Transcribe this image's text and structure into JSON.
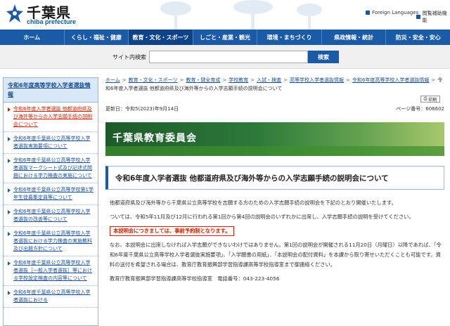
{
  "header": {
    "title": "千葉県",
    "subtitle": "chiba prefecture",
    "foreign_languages": "Foreign Languages",
    "reading_assist": "閲覧補助機能"
  },
  "nav": {
    "items": [
      {
        "label": "ホーム"
      },
      {
        "label": "くらし・福祉・健康"
      },
      {
        "label": "教育・文化・スポーツ"
      },
      {
        "label": "しごと・産業・観光"
      },
      {
        "label": "環境・まちづくり"
      },
      {
        "label": "県政情報・統計"
      },
      {
        "label": "防災・安全・安心"
      }
    ],
    "active_index": 2
  },
  "search": {
    "label": "サイト内検索",
    "placeholder": "",
    "button": "検索"
  },
  "sidebar": {
    "heading": "令和6年度高等学校入学者選抜情報",
    "items": [
      {
        "label": "令和6年度入学者選抜 他都道府県及び海外等からの入学志願手続の説明会について",
        "current": true
      },
      {
        "label": "令和6年度千葉県公立高等学校入学者選抜実施要項について"
      },
      {
        "label": "令和6年度千葉県公立高等学校入学者選抜マークシート式及び記述式問題における学力検査の実施について"
      },
      {
        "label": "令和6年度千葉県公立高等学校第1学年生徒募集定員等について"
      },
      {
        "label": "令和6年度千葉県公立高等学校入学者選抜の改善等について"
      },
      {
        "label": "令和6年度千葉県公立高等学校入学者選抜における学力検査の実施教科及び出題方針について"
      },
      {
        "label": "令和6年度千葉県公立高等学校入学者選抜［一般入学者選抜］等における学校設定検査の内容等について"
      },
      {
        "label": "令和6年度千葉県公立高等学校入学者選抜における"
      }
    ]
  },
  "breadcrumb": {
    "links": [
      "ホーム",
      "教育・文化・スポーツ",
      "教育・健全育成",
      "学校教育",
      "入試・検査",
      "高等学校入学者選抜情報",
      "令和6年度高等学校入学者選抜情報"
    ],
    "current": "令和6年度入学者選抜 他都道府県及び海外等からの入学志願手続の説明会について"
  },
  "print_label": "印刷",
  "meta": {
    "updated": "更新日：令和5(2023)年9月14日",
    "page_number": "ページ番号：606602"
  },
  "banner": {
    "text": "千葉県教育委員会"
  },
  "page_title": "令和6年度入学者選抜 他都道府県及び海外等からの入学志願手続の説明会について",
  "body": {
    "p1": "他都道府県及び海外等から千葉県公立高等学校を志願する方のための入学志願手続の説明会を下記のとおり開催いたします。",
    "p2": "ついては、令和5年11月及び12月に行われる第1回から第4回の説明会のいずれかに出席し、入学志願手続の説明を受けてください。",
    "notice": "本説明会につきましては、事前予約制となります。",
    "p3": "なお、本説明会に出席しなければ入学志願ができないわけではありません。第1回の説明会が開催される11月20日（月曜日）以降であれば、「令和6年度千葉県公立高等学校入学者選抜実施要項」、「入学願書の用紙」、「本説明会の配付資料」を本課から取り寄せいただくことも可能です。資料の送付を希望される場合は、教育庁教育振興部学習指導課高等学校指導室まで御連絡ください。",
    "contact": "教育庁教育振興部学習指導課高等学校指導室　電話番号：043-223-4056"
  }
}
